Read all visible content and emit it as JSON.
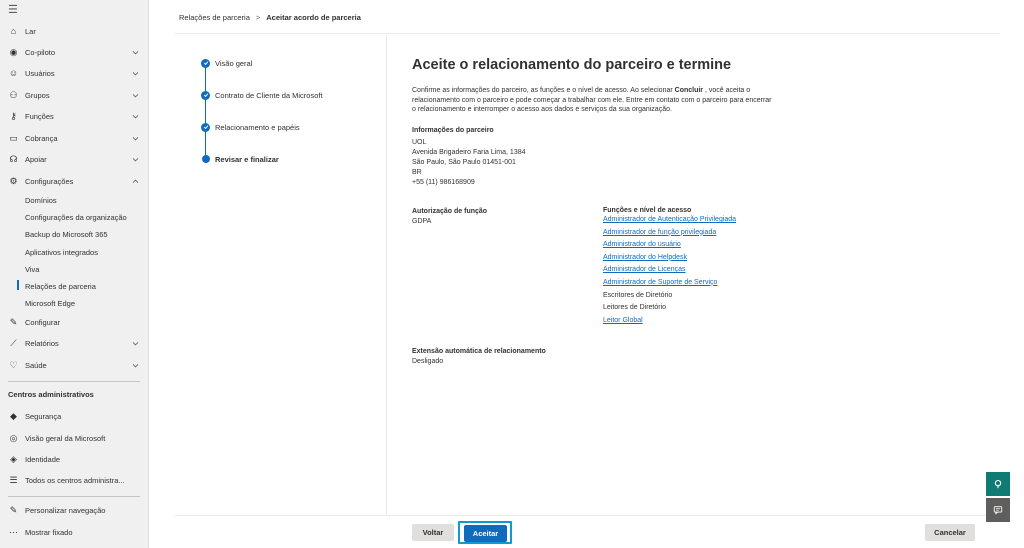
{
  "sidebar": {
    "items": [
      {
        "label": "Lar",
        "icon": "home-icon",
        "glyph": "⌂"
      },
      {
        "label": "Co-piloto",
        "icon": "copilot-icon",
        "glyph": "◉",
        "chevron": "down"
      },
      {
        "label": "Usuários",
        "icon": "user-icon",
        "glyph": "☺",
        "chevron": "down"
      },
      {
        "label": "Grupos",
        "icon": "groups-icon",
        "glyph": "⚇",
        "chevron": "down"
      },
      {
        "label": "Funções",
        "icon": "roles-icon",
        "glyph": "⚷",
        "chevron": "down"
      },
      {
        "label": "Cobrança",
        "icon": "billing-icon",
        "glyph": "▭",
        "chevron": "down"
      },
      {
        "label": "Apoiar",
        "icon": "support-icon",
        "glyph": "☊",
        "chevron": "down"
      },
      {
        "label": "Configurações",
        "icon": "settings-icon",
        "glyph": "⚙",
        "chevron": "up"
      }
    ],
    "subitems": [
      "Domínios",
      "Configurações da organização",
      "Backup do Microsoft 365",
      "Aplicativos integrados",
      "Viva",
      "Relações de parceria",
      "Microsoft Edge"
    ],
    "items2": [
      {
        "label": "Configurar",
        "icon": "setup-icon",
        "glyph": "✎"
      },
      {
        "label": "Relatórios",
        "icon": "reports-icon",
        "glyph": "⟋",
        "chevron": "down"
      },
      {
        "label": "Saúde",
        "icon": "health-icon",
        "glyph": "♡",
        "chevron": "down"
      }
    ],
    "admin_title": "Centros administrativos",
    "admin_items": [
      {
        "label": "Segurança",
        "icon": "shield-icon",
        "glyph": "◆"
      },
      {
        "label": "Visão geral da Microsoft",
        "icon": "overview-icon",
        "glyph": "◎"
      },
      {
        "label": "Identidade",
        "icon": "identity-icon",
        "glyph": "◈"
      },
      {
        "label": "Todos os centros administra...",
        "icon": "all-centers-icon",
        "glyph": "☰"
      }
    ],
    "bottom_items": [
      {
        "label": "Personalizar navegação",
        "icon": "edit-icon",
        "glyph": "✎"
      },
      {
        "label": "Mostrar fixado",
        "icon": "more-icon",
        "glyph": "⋯"
      }
    ]
  },
  "breadcrumb": {
    "parent": "Relações de parceria",
    "separator": ">",
    "current": "Aceitar acordo de parceria"
  },
  "steps": [
    "Visão geral",
    "Contrato de Cliente da Microsoft",
    "Relacionamento e papéis",
    "Revisar e finalizar"
  ],
  "main": {
    "title": "Aceite o relacionamento do parceiro e termine",
    "desc_pre": "Confirme as informações do parceiro, as funções e o nível de acesso. Ao selecionar ",
    "desc_bold": "Concluir",
    "desc_post": " , você aceita o relacionamento com o parceiro e pode começar a trabalhar com ele. Entre em contato com o parceiro para encerrar o relacionamento e interromper o acesso aos dados e serviços da sua organização.",
    "partner_title": "Informações do parceiro",
    "partner_lines": [
      "UOL",
      "Avenida Brigadeiro Faria Lima, 1384",
      "São Paulo, São Paulo 01451-001",
      "BR",
      "+55 (11) 986168909"
    ],
    "auth_title": "Autorização de função",
    "auth_value": "GDPA",
    "roles_title": "Funções e nível de acesso",
    "roles": [
      {
        "label": "Administrador de Autenticação Privilegiada",
        "link": true
      },
      {
        "label": "Administrador de função privilegiada",
        "link": true
      },
      {
        "label": "Administrador do usuário",
        "link": true
      },
      {
        "label": "Administrador do Helpdesk",
        "link": true
      },
      {
        "label": "Administrador de Licenças",
        "link": true
      },
      {
        "label": "Administrador de Suporte de Serviço",
        "link": true
      },
      {
        "label": "Escritores de Diretório",
        "link": false
      },
      {
        "label": "Leitores de Diretório",
        "link": false
      },
      {
        "label": "Leitor Global",
        "link": true
      }
    ],
    "ext_title": "Extensão automática de relacionamento",
    "ext_value": "Desligado"
  },
  "footer": {
    "back": "Voltar",
    "accept": "Aceitar",
    "cancel": "Cancelar"
  },
  "colors": {
    "accent": "#0f6cbd",
    "fab": "#0f7b73",
    "fab2": "#605e5c"
  }
}
